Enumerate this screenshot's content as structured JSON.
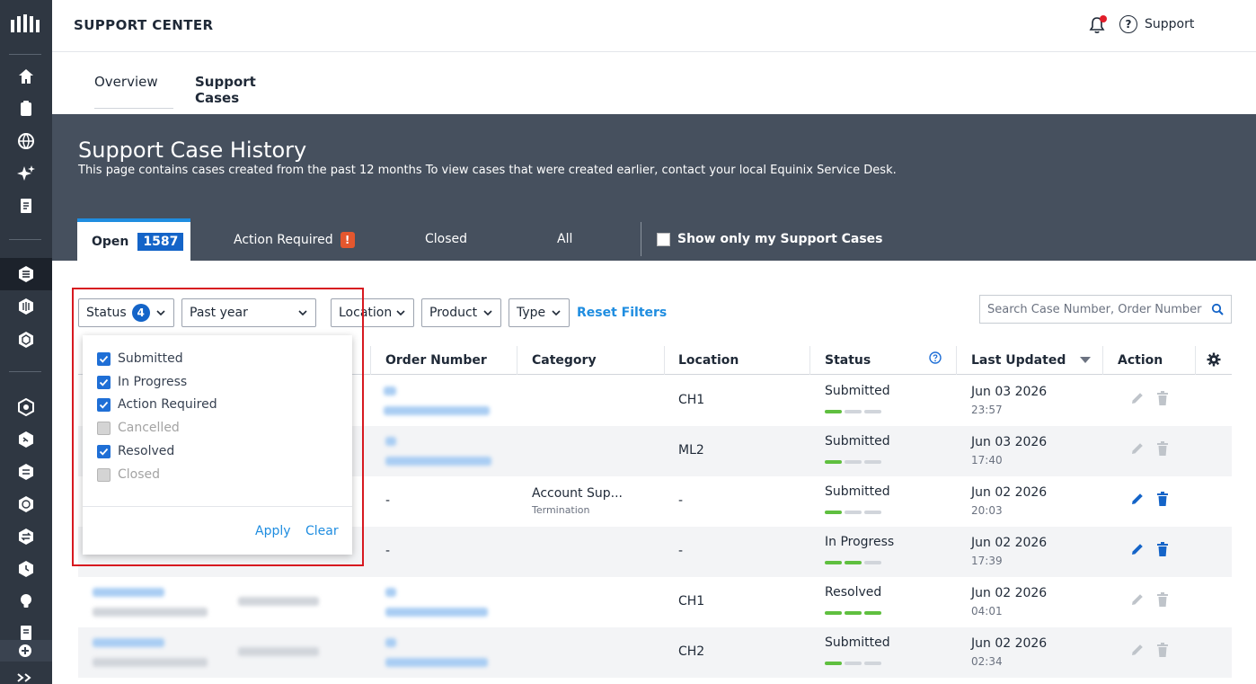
{
  "app": {
    "title": "SUPPORT CENTER",
    "support_label": "Support",
    "help_glyph": "?"
  },
  "page_tabs": [
    {
      "label": "Overview",
      "active": false
    },
    {
      "label": "Support Cases",
      "active": true
    }
  ],
  "hero": {
    "title": "Support Case History",
    "subtitle": "This page contains cases created from the past 12 months To view cases that were created earlier, contact your local Equinix Service Desk.",
    "tabs": {
      "open": {
        "label": "Open",
        "count": "1587"
      },
      "action_required": {
        "label": "Action Required",
        "warn_glyph": "!"
      },
      "closed": {
        "label": "Closed"
      },
      "all": {
        "label": "All"
      }
    },
    "my_cases_label": "Show only my Support Cases"
  },
  "filters": {
    "status": {
      "label": "Status",
      "count": "4"
    },
    "period": {
      "value": "Past year"
    },
    "location": {
      "label": "Location"
    },
    "product": {
      "label": "Product"
    },
    "type": {
      "label": "Type"
    },
    "reset_label": "Reset Filters",
    "search_placeholder": "Search Case Number, Order Number"
  },
  "status_popup": {
    "options": [
      {
        "label": "Submitted",
        "checked": true
      },
      {
        "label": "In Progress",
        "checked": true
      },
      {
        "label": "Action Required",
        "checked": true
      },
      {
        "label": "Cancelled",
        "checked": false
      },
      {
        "label": "Resolved",
        "checked": true
      },
      {
        "label": "Closed",
        "checked": false
      }
    ],
    "apply_label": "Apply",
    "clear_label": "Clear"
  },
  "table": {
    "columns": [
      "Order Number",
      "Category",
      "Location",
      "Status",
      "Last Updated",
      "Action"
    ],
    "rows": [
      {
        "order": "",
        "category": "",
        "category_sub": "",
        "location": "CH1",
        "status": "Submitted",
        "progress": 1,
        "date": "Jun 03 2026",
        "time": "23:57",
        "editable": false
      },
      {
        "order": "",
        "category": "",
        "category_sub": "",
        "location": "ML2",
        "status": "Submitted",
        "progress": 1,
        "date": "Jun 03 2026",
        "time": "17:40",
        "editable": false
      },
      {
        "order": "-",
        "category": "Account Sup...",
        "category_sub": "Termination",
        "location": "-",
        "status": "Submitted",
        "progress": 1,
        "date": "Jun 02 2026",
        "time": "20:03",
        "editable": true
      },
      {
        "order": "-",
        "category": "",
        "category_sub": "",
        "location": "-",
        "status": "In Progress",
        "progress": 2,
        "date": "Jun 02 2026",
        "time": "17:39",
        "editable": true
      },
      {
        "order": "",
        "category": "",
        "category_sub": "",
        "location": "CH1",
        "status": "Resolved",
        "progress": 3,
        "date": "Jun 02 2026",
        "time": "04:01",
        "editable": false
      },
      {
        "order": "",
        "category": "",
        "category_sub": "",
        "location": "CH2",
        "status": "Submitted",
        "progress": 1,
        "date": "Jun 02 2026",
        "time": "02:34",
        "editable": false
      }
    ]
  },
  "colors": {
    "accent": "#1f8de0",
    "brand_blue": "#1464c8",
    "hero_bg": "#46505e",
    "rail_bg": "#2f3742",
    "progress_on": "#5fbf3f",
    "highlight": "#d71920"
  },
  "icons": [
    "equinix-logo-icon",
    "home-icon",
    "clipboard-icon",
    "globe-icon",
    "sparkle-icon",
    "document-icon",
    "service-icon",
    "cube-icon",
    "hexagon-icon",
    "bell-icon",
    "help-icon",
    "search-icon",
    "chevron-down-icon",
    "settings-icon",
    "edit-icon",
    "delete-icon",
    "sort-desc-icon",
    "info-icon"
  ]
}
